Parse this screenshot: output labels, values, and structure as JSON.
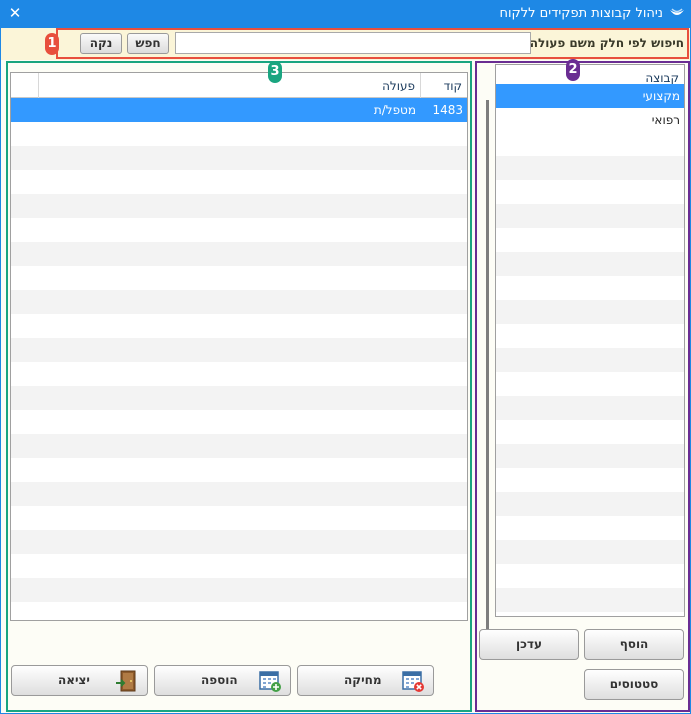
{
  "window": {
    "title": "ניהול קבוצות תפקידים ללקוח",
    "close_icon": "close-icon",
    "app_icon": "app-logo-icon"
  },
  "search": {
    "label": "חיפוש לפי חלק משם פעולה",
    "value": "",
    "placeholder": "",
    "search_label": "חפש",
    "clear_label": "נקה"
  },
  "markers": {
    "m1": "1",
    "m2": "2",
    "m3": "3"
  },
  "groups_panel": {
    "column": "קבוצה",
    "rows": [
      {
        "name": "מקצועי",
        "selected": true
      },
      {
        "name": "רפואי",
        "selected": false
      }
    ],
    "add_label": "הוסף",
    "update_label": "עדכן",
    "statuses_label": "סטטוסים"
  },
  "actions_panel": {
    "columns": {
      "code": "קוד",
      "action": "פעולה"
    },
    "rows": [
      {
        "code": "1483",
        "action": "מטפל/ת",
        "selected": true
      }
    ],
    "delete_label": "מחיקה",
    "add_label": "הוספה",
    "exit_label": "יציאה"
  },
  "colors": {
    "titlebar": "#1e88e5",
    "selection": "#3399ff",
    "marker_red": "#e84f3d",
    "marker_purple": "#6a2d92",
    "marker_green": "#1aa580"
  }
}
